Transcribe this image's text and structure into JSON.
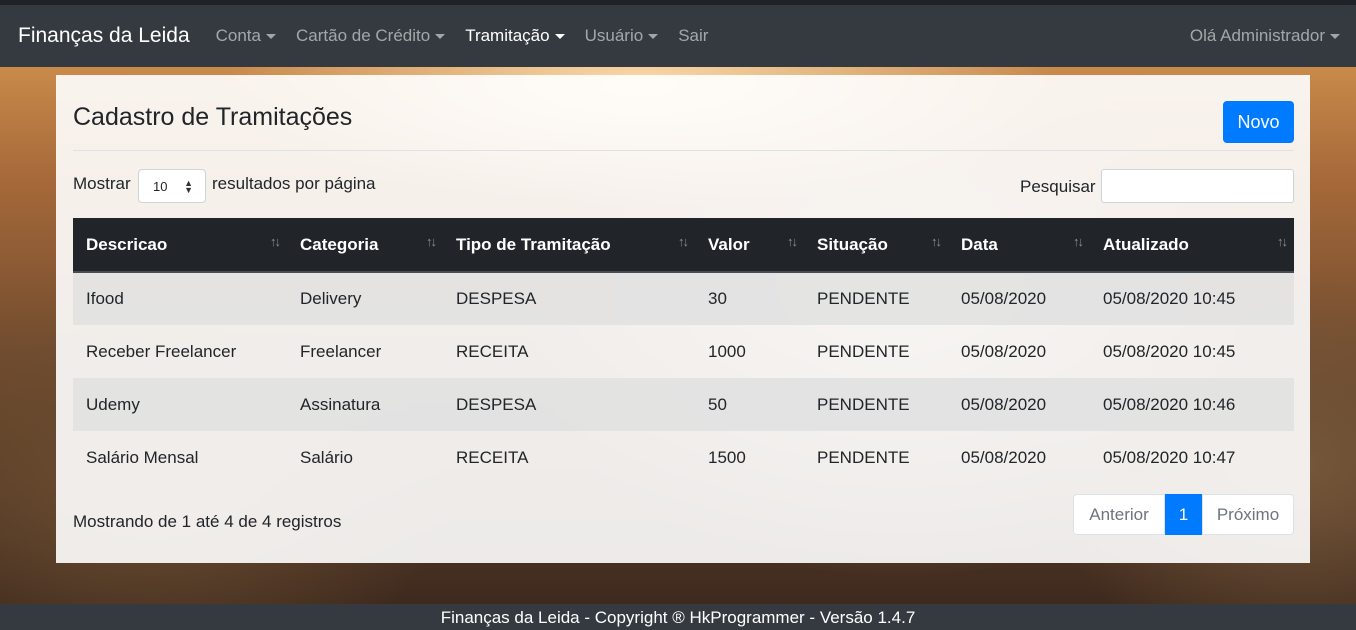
{
  "navbar": {
    "brand": "Finanças da Leida",
    "items": [
      {
        "label": "Conta"
      },
      {
        "label": "Cartão de Crédito"
      },
      {
        "label": "Tramitação"
      },
      {
        "label": "Usuário"
      },
      {
        "label": "Sair"
      }
    ],
    "user": "Olá Administrador"
  },
  "page": {
    "title": "Cadastro de Tramitações",
    "new_button": "Novo",
    "length_prefix": "Mostrar",
    "length_value": "10",
    "length_suffix": "resultados por página",
    "search_label": "Pesquisar",
    "search_value": ""
  },
  "table": {
    "headers": [
      "Descricao",
      "Categoria",
      "Tipo de Tramitação",
      "Valor",
      "Situação",
      "Data",
      "Atualizado"
    ],
    "rows": [
      [
        "Ifood",
        "Delivery",
        "DESPESA",
        "30",
        "PENDENTE",
        "05/08/2020",
        "05/08/2020 10:45"
      ],
      [
        "Receber Freelancer",
        "Freelancer",
        "RECEITA",
        "1000",
        "PENDENTE",
        "05/08/2020",
        "05/08/2020 10:45"
      ],
      [
        "Udemy",
        "Assinatura",
        "DESPESA",
        "50",
        "PENDENTE",
        "05/08/2020",
        "05/08/2020 10:46"
      ],
      [
        "Salário Mensal",
        "Salário",
        "RECEITA",
        "1500",
        "PENDENTE",
        "05/08/2020",
        "05/08/2020 10:47"
      ]
    ]
  },
  "info": "Mostrando de 1 até 4 de 4 registros",
  "pager": {
    "prev": "Anterior",
    "current": "1",
    "next": "Próximo"
  },
  "footer": "Finanças da Leida - Copyright ® HkProgrammer - Versão 1.4.7",
  "colors": {
    "primary": "#007bff",
    "navbar": "#343a40",
    "table_head": "#212529"
  }
}
